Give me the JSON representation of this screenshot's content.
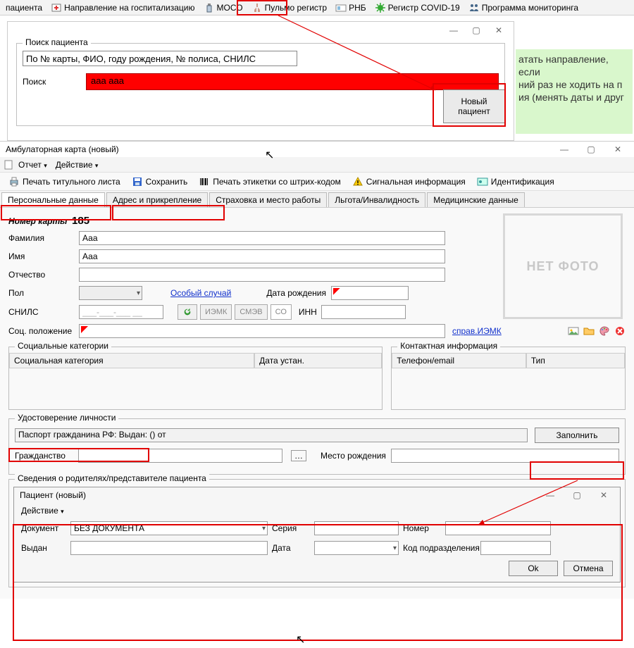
{
  "topbar": {
    "items": [
      {
        "label": "пациента"
      },
      {
        "label": "Направление на госпитализацию"
      },
      {
        "label": "МОСО"
      },
      {
        "label": "Пульмо регистр"
      },
      {
        "label": "РНБ"
      },
      {
        "label": "Регистр COVID-19"
      },
      {
        "label": "Программа мониторинга"
      }
    ]
  },
  "search": {
    "group_title": "Поиск пациента",
    "placeholder": "По № карты, ФИО, году рождения, № полиса, СНИЛС",
    "search_label": "Поиск",
    "search_value": "ааа ааа",
    "new_patient": "Новый\nпациент"
  },
  "green_text": "атать направление, если\nний раз не ходить на п\nия (менять даты и друг",
  "main": {
    "title": "Амбулаторная карта (новый)",
    "menu": {
      "otchet": "Отчет",
      "deistvie": "Действие"
    },
    "toolbar": {
      "print_title": "Печать титульного листа",
      "save": "Сохранить",
      "print_barcode": "Печать этикетки со штрих-кодом",
      "signal": "Сигнальная информация",
      "ident": "Идентификация"
    },
    "tabs": {
      "personal": "Персональные данные",
      "address": "Адрес и прикрепление",
      "insurance": "Страховка и место работы",
      "lgota": "Льгота/Инвалидность",
      "med": "Медицинские данные"
    },
    "card_no_label": "Номер карты",
    "card_no": "185",
    "surname_l": "Фамилия",
    "surname": "Ааа",
    "name_l": "Имя",
    "name": "Ааа",
    "patr_l": "Отчество",
    "patr": "",
    "sex_l": "Пол",
    "special": "Особый случай",
    "dob_l": "Дата рождения",
    "snils_l": "СНИЛС",
    "snils": "___-___-___ __",
    "iemk": "ИЭМК",
    "smev": "СМЭВ",
    "so": "СО",
    "inn_l": "ИНН",
    "soc_l": "Соц. положение",
    "sprav": "справ.ИЭМК",
    "no_photo": "НЕТ ФОТО",
    "soc_cat": {
      "title": "Социальные категории",
      "col1": "Социальная категория",
      "col2": "Дата устан."
    },
    "contact": {
      "title": "Контактная информация",
      "col1": "Телефон/email",
      "col2": "Тип"
    },
    "idcard": {
      "title": "Удостоверение личности",
      "passport": "Паспорт гражданина РФ:   Выдан: () от",
      "fill": "Заполнить",
      "citizenship_l": "Гражданство",
      "birthplace_l": "Место рождения"
    },
    "parents_title": "Сведения о родителях/представителе пациента",
    "subdlg": {
      "title": "Пациент (новый)",
      "menu": "Действие",
      "doc_l": "Документ",
      "doc_v": "БЕЗ ДОКУМЕНТА",
      "series_l": "Серия",
      "number_l": "Номер",
      "issued_l": "Выдан",
      "date_l": "Дата",
      "code_l": "Код подразделения",
      "ok": "Ok",
      "cancel": "Отмена"
    }
  }
}
